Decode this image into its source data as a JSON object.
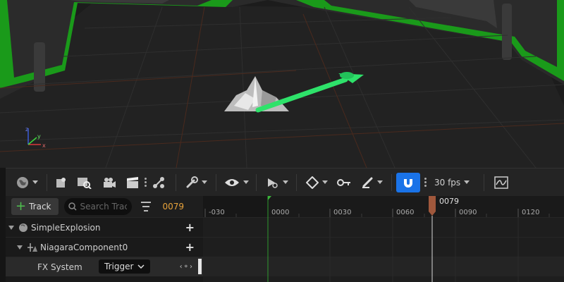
{
  "toolbar": {
    "fps": "30 fps",
    "icons": [
      "world-icon",
      "render-settings-icon",
      "camera-search-icon",
      "camera-icon",
      "clapperboard-icon",
      "more-icon",
      "graph-icon",
      "wrench-icon",
      "eye-icon",
      "playback-icon",
      "keyframe-icon",
      "key-icon",
      "brush-icon",
      "magnet-snap-icon",
      "curve-editor-icon"
    ]
  },
  "outliner": {
    "track_button": "Track",
    "search_placeholder": "Search Tracks",
    "current_frame": "0079",
    "rows": [
      {
        "label": "SimpleExplosion"
      },
      {
        "label": "NiagaraComponent0"
      },
      {
        "label": "FX System",
        "dropdown": "Trigger"
      }
    ]
  },
  "timeline": {
    "ticks": [
      "-030",
      "0000",
      "0030",
      "0060",
      "0090",
      "0120"
    ],
    "playhead_label": "0079"
  },
  "colors": {
    "accent_blue": "#1a73e8",
    "playhead": "#a0583c",
    "frame_orange": "#e8a33b",
    "green_marker": "#3bb53b"
  }
}
